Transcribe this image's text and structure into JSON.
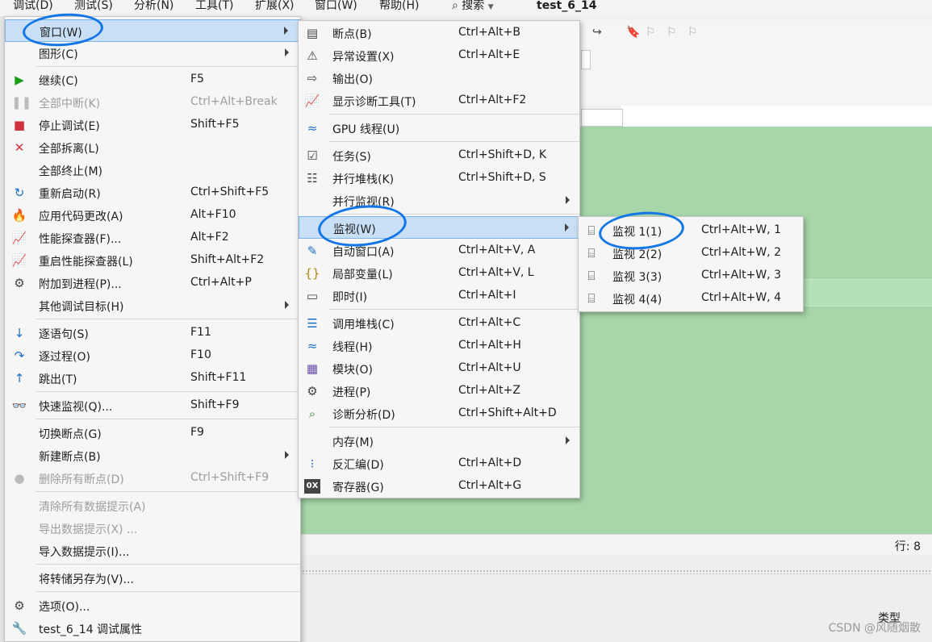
{
  "menubar": {
    "items": [
      "调试(D)",
      "测试(S)",
      "分析(N)",
      "工具(T)",
      "扩展(X)",
      "窗口(W)",
      "帮助(H)"
    ],
    "search": "搜索",
    "title": "test_6_14"
  },
  "status": {
    "position": "行: 8"
  },
  "lower": {
    "type_label": "类型",
    "watermark": "CSDN @风随烟散"
  },
  "debug_menu": {
    "items": [
      {
        "label": "窗口(W)",
        "shortcut": "",
        "icon": "",
        "submenu": true,
        "highlighted": true
      },
      {
        "label": "图形(C)",
        "shortcut": "",
        "icon": "",
        "submenu": true
      },
      {
        "label": "继续(C)",
        "shortcut": "F5",
        "icon": "play-icon"
      },
      {
        "label": "全部中断(K)",
        "shortcut": "Ctrl+Alt+Break",
        "icon": "pause-icon",
        "disabled": true
      },
      {
        "label": "停止调试(E)",
        "shortcut": "Shift+F5",
        "icon": "stop-icon"
      },
      {
        "label": "全部拆离(L)",
        "shortcut": "",
        "icon": "close-icon"
      },
      {
        "label": "全部终止(M)",
        "shortcut": "",
        "icon": ""
      },
      {
        "label": "重新启动(R)",
        "shortcut": "Ctrl+Shift+F5",
        "icon": "restart-icon"
      },
      {
        "label": "应用代码更改(A)",
        "shortcut": "Alt+F10",
        "icon": "hot-reload-icon"
      },
      {
        "label": "性能探查器(F)...",
        "shortcut": "Alt+F2",
        "icon": "chart-icon"
      },
      {
        "label": "重启性能探查器(L)",
        "shortcut": "Shift+Alt+F2",
        "icon": "chart-icon"
      },
      {
        "label": "附加到进程(P)...",
        "shortcut": "Ctrl+Alt+P",
        "icon": "gears-icon"
      },
      {
        "label": "其他调试目标(H)",
        "shortcut": "",
        "icon": "",
        "submenu": true
      },
      {
        "label": "逐语句(S)",
        "shortcut": "F11",
        "icon": "step-into-icon"
      },
      {
        "label": "逐过程(O)",
        "shortcut": "F10",
        "icon": "step-over-icon"
      },
      {
        "label": "跳出(T)",
        "shortcut": "Shift+F11",
        "icon": "step-out-icon"
      },
      {
        "label": "快速监视(Q)...",
        "shortcut": "Shift+F9",
        "icon": "glasses-icon"
      },
      {
        "label": "切换断点(G)",
        "shortcut": "F9",
        "icon": ""
      },
      {
        "label": "新建断点(B)",
        "shortcut": "",
        "icon": "",
        "submenu": true
      },
      {
        "label": "删除所有断点(D)",
        "shortcut": "Ctrl+Shift+F9",
        "icon": "delete-breakpoints-icon",
        "disabled": true
      },
      {
        "label": "清除所有数据提示(A)",
        "shortcut": "",
        "icon": "",
        "disabled": true
      },
      {
        "label": "导出数据提示(X) ...",
        "shortcut": "",
        "icon": "",
        "disabled": true
      },
      {
        "label": "导入数据提示(I)...",
        "shortcut": "",
        "icon": ""
      },
      {
        "label": "将转储另存为(V)...",
        "shortcut": "",
        "icon": ""
      },
      {
        "label": "选项(O)...",
        "shortcut": "",
        "icon": "gear-icon"
      },
      {
        "label": "test_6_14 调试属性",
        "shortcut": "",
        "icon": "wrench-icon"
      }
    ]
  },
  "window_menu": {
    "items": [
      {
        "label": "断点(B)",
        "shortcut": "Ctrl+Alt+B",
        "icon": "breakpoints-window-icon"
      },
      {
        "label": "异常设置(X)",
        "shortcut": "Ctrl+Alt+E",
        "icon": "exception-icon"
      },
      {
        "label": "输出(O)",
        "shortcut": "",
        "icon": "output-icon"
      },
      {
        "label": "显示诊断工具(T)",
        "shortcut": "Ctrl+Alt+F2",
        "icon": "chart-icon"
      },
      {
        "label": "GPU 线程(U)",
        "shortcut": "",
        "icon": "threads-icon"
      },
      {
        "label": "任务(S)",
        "shortcut": "Ctrl+Shift+D, K",
        "icon": "tasks-icon"
      },
      {
        "label": "并行堆栈(K)",
        "shortcut": "Ctrl+Shift+D, S",
        "icon": "parallel-stacks-icon"
      },
      {
        "label": "并行监视(R)",
        "shortcut": "",
        "icon": "",
        "submenu": true
      },
      {
        "label": "监视(W)",
        "shortcut": "",
        "icon": "",
        "submenu": true,
        "highlighted": true
      },
      {
        "label": "自动窗口(A)",
        "shortcut": "Ctrl+Alt+V, A",
        "icon": "autos-icon"
      },
      {
        "label": "局部变量(L)",
        "shortcut": "Ctrl+Alt+V, L",
        "icon": "locals-icon"
      },
      {
        "label": "即时(I)",
        "shortcut": "Ctrl+Alt+I",
        "icon": "immediate-icon"
      },
      {
        "label": "调用堆栈(C)",
        "shortcut": "Ctrl+Alt+C",
        "icon": "call-stack-icon"
      },
      {
        "label": "线程(H)",
        "shortcut": "Ctrl+Alt+H",
        "icon": "threads-icon"
      },
      {
        "label": "模块(O)",
        "shortcut": "Ctrl+Alt+U",
        "icon": "modules-icon"
      },
      {
        "label": "进程(P)",
        "shortcut": "Ctrl+Alt+Z",
        "icon": "gears-icon"
      },
      {
        "label": "诊断分析(D)",
        "shortcut": "Ctrl+Shift+Alt+D",
        "icon": "diagnostics-icon"
      },
      {
        "label": "内存(M)",
        "shortcut": "",
        "icon": "",
        "submenu": true
      },
      {
        "label": "反汇编(D)",
        "shortcut": "Ctrl+Alt+D",
        "icon": "disassembly-icon"
      },
      {
        "label": "寄存器(G)",
        "shortcut": "Ctrl+Alt+G",
        "icon": "registers-icon"
      }
    ]
  },
  "watch_menu": {
    "items": [
      {
        "label": "监视 1(1)",
        "shortcut": "Ctrl+Alt+W, 1",
        "icon": "watch-icon"
      },
      {
        "label": "监视 2(2)",
        "shortcut": "Ctrl+Alt+W, 2",
        "icon": "watch-icon"
      },
      {
        "label": "监视 3(3)",
        "shortcut": "Ctrl+Alt+W, 3",
        "icon": "watch-icon"
      },
      {
        "label": "监视 4(4)",
        "shortcut": "Ctrl+Alt+W, 4",
        "icon": "watch-icon"
      }
    ]
  },
  "colors": {
    "highlight": "#c9dff5",
    "annotation": "#1276e6",
    "editor_bg": "#a6d6a9"
  }
}
